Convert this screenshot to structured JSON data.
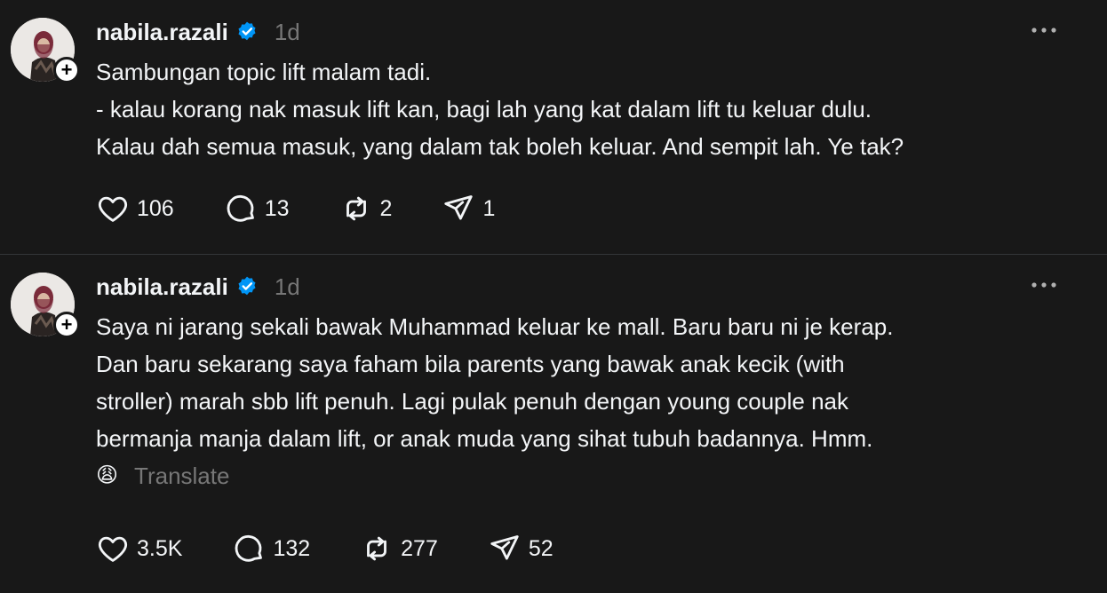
{
  "posts": [
    {
      "username": "nabila.razali",
      "time": "1d",
      "lines": [
        "Sambungan topic lift malam tadi.",
        "- kalau korang nak masuk lift kan, bagi lah yang kat dalam lift tu keluar dulu.",
        "Kalau dah semua masuk, yang dalam tak boleh keluar. And sempit lah. Ye tak?"
      ],
      "likes": "106",
      "replies": "13",
      "reposts": "2",
      "shares": "1"
    },
    {
      "username": "nabila.razali",
      "time": "1d",
      "lines": [
        "Saya ni jarang sekali bawak Muhammad keluar ke mall. Baru baru ni je kerap.",
        "Dan baru sekarang saya faham bila parents yang bawak anak kecik (with",
        "stroller) marah sbb lift penuh. Lagi pulak penuh dengan young couple nak",
        "bermanja manja dalam lift, or anak muda yang sihat tubuh badannya. Hmm."
      ],
      "emoji": "😩",
      "translate": "Translate",
      "likes": "3.5K",
      "replies": "132",
      "reposts": "277",
      "shares": "52"
    }
  ],
  "colors": {
    "background": "#181818",
    "text": "#f3f5f7",
    "muted": "#777777",
    "verified": "#0095f6",
    "divider": "#333638"
  },
  "icons": [
    "verified-badge-icon",
    "more-options-icon",
    "heart-icon",
    "reply-bubble-icon",
    "repost-icon",
    "share-send-icon",
    "follow-plus-icon"
  ]
}
